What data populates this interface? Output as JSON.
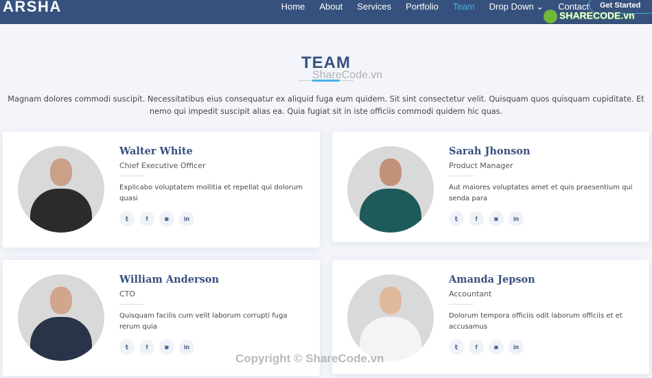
{
  "header": {
    "logo": "ARSHA",
    "menu": [
      "Home",
      "About",
      "Services",
      "Portfolio",
      "Team",
      "Drop Down ⌄",
      "Contact"
    ],
    "active": "Team",
    "cta": "Get Started"
  },
  "watermark": {
    "badge": "SHARECODE.vn",
    "center": "ShareCode.vn",
    "footer": "Copyright © ShareCode.vn"
  },
  "section": {
    "title": "TEAM",
    "description": "Magnam dolores commodi suscipit. Necessitatibus eius consequatur ex aliquid fuga eum quidem. Sit sint consectetur velit. Quisquam quos quisquam cupiditate. Et nemo qui impedit suscipit alias ea. Quia fugiat sit in iste officiis commodi quidem hic quas."
  },
  "social_icons": [
    "twitter-icon",
    "facebook-icon",
    "instagram-icon",
    "linkedin-icon"
  ],
  "members": [
    {
      "name": "Walter White",
      "role": "Chief Executive Officer",
      "text": "Explicabo voluptatem mollitia et repellat qui dolorum quasi"
    },
    {
      "name": "Sarah Jhonson",
      "role": "Product Manager",
      "text": "Aut maiores voluptates amet et quis praesentium qui senda para"
    },
    {
      "name": "William Anderson",
      "role": "CTO",
      "text": "Quisquam facilis cum velit laborum corrupti fuga rerum quia"
    },
    {
      "name": "Amanda Jepson",
      "role": "Accountant",
      "text": "Dolorum tempora officiis odit laborum officiis et et accusamus"
    }
  ],
  "colors": {
    "nav": "#37517e",
    "accent": "#47b2e4",
    "bg": "#f3f5fa"
  }
}
